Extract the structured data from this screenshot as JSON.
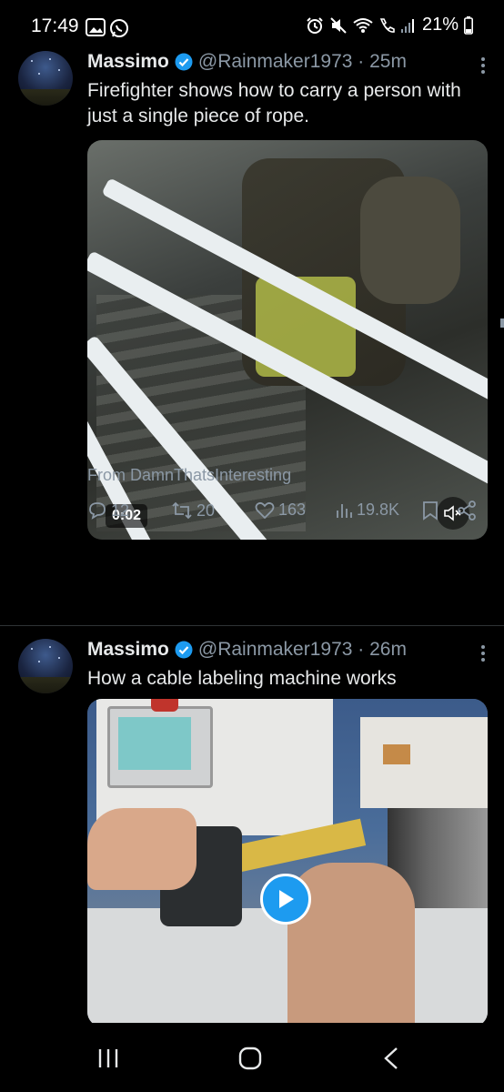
{
  "status_bar": {
    "time": "17:49",
    "battery": "21%",
    "left_icons": [
      "gallery-icon",
      "whatsapp-icon"
    ],
    "right_icons": [
      "alarm-icon",
      "mute-icon",
      "wifi-icon",
      "wifi-calling-icon",
      "signal-icon",
      "battery-icon"
    ]
  },
  "tweets": [
    {
      "name": "Massimo",
      "handle": "@Rainmaker1973 · 25m",
      "text": "Firefighter shows how to carry a person with just a single piece of rope.",
      "media_type": "video",
      "duration": "0:02",
      "source": "From DamnThatsInteresting",
      "replies": "12",
      "retweets": "20",
      "likes": "163",
      "views": "19.8K"
    },
    {
      "name": "Massimo",
      "handle": "@Rainmaker1973 · 26m",
      "text": "How a cable labeling machine works",
      "media_type": "video"
    }
  ],
  "colors": {
    "background": "#000000",
    "text": "#e7e9ea",
    "muted": "#8b98a5",
    "accent": "#1d9bf0",
    "divider": "#2f3336"
  }
}
